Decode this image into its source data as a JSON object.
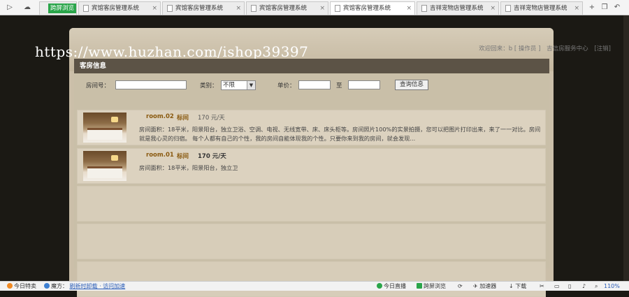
{
  "browser": {
    "tabs": [
      {
        "label": "跨屏浏览",
        "active": false
      },
      {
        "label": "宾馆客房管理系统",
        "active": false
      },
      {
        "label": "宾馆客房管理系统",
        "active": false
      },
      {
        "label": "宾馆客房管理系统",
        "active": false
      },
      {
        "label": "宾馆客房管理系统",
        "active": true
      },
      {
        "label": "吉祥宠物店管理系统",
        "active": false
      },
      {
        "label": "吉祥宠物店管理系统",
        "active": false
      }
    ],
    "close_glyph": "×",
    "new_tab_glyph": "+"
  },
  "header": {
    "watermark": "https://www.huzhan.com/ishop39397",
    "welcome": "欢迎回来：b [ 操作员 ]",
    "center_link": "吉信房服务中心",
    "logout": "[注销]"
  },
  "section": {
    "title": "客房信息"
  },
  "search": {
    "room_no_label": "房间号：",
    "room_no_value": "",
    "type_label": "类别：",
    "type_selected": "不限",
    "price_label": "单价：",
    "price_min": "",
    "to_label": "至",
    "price_max": "",
    "submit_label": "查询信息"
  },
  "rooms": [
    {
      "room_no": "room.02",
      "type": "标间",
      "price": "170 元/天",
      "description": "房间面积：18平米，阳景阳台，独立卫浴、空调、电视、无线宽带、床、床头柜等。房间照片100%的实景拍摄，您可以把图片打印出来，来了一一对比。房间就是我心灵的归宿。 每个人都有自己的个性，我的房间自能体现我的个性。只要你来到我的房间，就会发现..."
    },
    {
      "room_no": "room.01",
      "type": "标间",
      "price": "170 元/天",
      "description": "房间面积：18平米，阳景阳台，独立卫"
    }
  ],
  "statusbar": {
    "today": "今日特卖",
    "tip_label": "魔方：",
    "tip_link": "刷新时卸载 · 访问加速",
    "live": "今日直播",
    "cross_screen": "跨屏浏览",
    "accelerator": "加速器",
    "download": "下载",
    "zoom": "110%"
  },
  "colors": {
    "section_header": "#5c5346",
    "panel": "#cbbfa9",
    "accent_text": "#8a5a10",
    "page_bg": "#1b1914"
  }
}
